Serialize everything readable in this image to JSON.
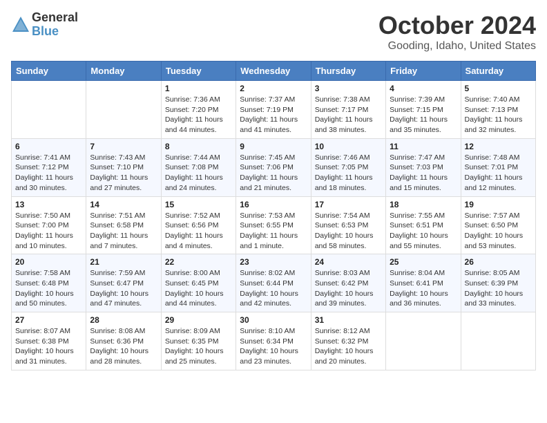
{
  "header": {
    "logo_general": "General",
    "logo_blue": "Blue",
    "month_title": "October 2024",
    "location": "Gooding, Idaho, United States"
  },
  "days_of_week": [
    "Sunday",
    "Monday",
    "Tuesday",
    "Wednesday",
    "Thursday",
    "Friday",
    "Saturday"
  ],
  "weeks": [
    [
      {
        "day": "",
        "info": ""
      },
      {
        "day": "",
        "info": ""
      },
      {
        "day": "1",
        "sunrise": "Sunrise: 7:36 AM",
        "sunset": "Sunset: 7:20 PM",
        "daylight": "Daylight: 11 hours and 44 minutes."
      },
      {
        "day": "2",
        "sunrise": "Sunrise: 7:37 AM",
        "sunset": "Sunset: 7:19 PM",
        "daylight": "Daylight: 11 hours and 41 minutes."
      },
      {
        "day": "3",
        "sunrise": "Sunrise: 7:38 AM",
        "sunset": "Sunset: 7:17 PM",
        "daylight": "Daylight: 11 hours and 38 minutes."
      },
      {
        "day": "4",
        "sunrise": "Sunrise: 7:39 AM",
        "sunset": "Sunset: 7:15 PM",
        "daylight": "Daylight: 11 hours and 35 minutes."
      },
      {
        "day": "5",
        "sunrise": "Sunrise: 7:40 AM",
        "sunset": "Sunset: 7:13 PM",
        "daylight": "Daylight: 11 hours and 32 minutes."
      }
    ],
    [
      {
        "day": "6",
        "sunrise": "Sunrise: 7:41 AM",
        "sunset": "Sunset: 7:12 PM",
        "daylight": "Daylight: 11 hours and 30 minutes."
      },
      {
        "day": "7",
        "sunrise": "Sunrise: 7:43 AM",
        "sunset": "Sunset: 7:10 PM",
        "daylight": "Daylight: 11 hours and 27 minutes."
      },
      {
        "day": "8",
        "sunrise": "Sunrise: 7:44 AM",
        "sunset": "Sunset: 7:08 PM",
        "daylight": "Daylight: 11 hours and 24 minutes."
      },
      {
        "day": "9",
        "sunrise": "Sunrise: 7:45 AM",
        "sunset": "Sunset: 7:06 PM",
        "daylight": "Daylight: 11 hours and 21 minutes."
      },
      {
        "day": "10",
        "sunrise": "Sunrise: 7:46 AM",
        "sunset": "Sunset: 7:05 PM",
        "daylight": "Daylight: 11 hours and 18 minutes."
      },
      {
        "day": "11",
        "sunrise": "Sunrise: 7:47 AM",
        "sunset": "Sunset: 7:03 PM",
        "daylight": "Daylight: 11 hours and 15 minutes."
      },
      {
        "day": "12",
        "sunrise": "Sunrise: 7:48 AM",
        "sunset": "Sunset: 7:01 PM",
        "daylight": "Daylight: 11 hours and 12 minutes."
      }
    ],
    [
      {
        "day": "13",
        "sunrise": "Sunrise: 7:50 AM",
        "sunset": "Sunset: 7:00 PM",
        "daylight": "Daylight: 11 hours and 10 minutes."
      },
      {
        "day": "14",
        "sunrise": "Sunrise: 7:51 AM",
        "sunset": "Sunset: 6:58 PM",
        "daylight": "Daylight: 11 hours and 7 minutes."
      },
      {
        "day": "15",
        "sunrise": "Sunrise: 7:52 AM",
        "sunset": "Sunset: 6:56 PM",
        "daylight": "Daylight: 11 hours and 4 minutes."
      },
      {
        "day": "16",
        "sunrise": "Sunrise: 7:53 AM",
        "sunset": "Sunset: 6:55 PM",
        "daylight": "Daylight: 11 hours and 1 minute."
      },
      {
        "day": "17",
        "sunrise": "Sunrise: 7:54 AM",
        "sunset": "Sunset: 6:53 PM",
        "daylight": "Daylight: 10 hours and 58 minutes."
      },
      {
        "day": "18",
        "sunrise": "Sunrise: 7:55 AM",
        "sunset": "Sunset: 6:51 PM",
        "daylight": "Daylight: 10 hours and 55 minutes."
      },
      {
        "day": "19",
        "sunrise": "Sunrise: 7:57 AM",
        "sunset": "Sunset: 6:50 PM",
        "daylight": "Daylight: 10 hours and 53 minutes."
      }
    ],
    [
      {
        "day": "20",
        "sunrise": "Sunrise: 7:58 AM",
        "sunset": "Sunset: 6:48 PM",
        "daylight": "Daylight: 10 hours and 50 minutes."
      },
      {
        "day": "21",
        "sunrise": "Sunrise: 7:59 AM",
        "sunset": "Sunset: 6:47 PM",
        "daylight": "Daylight: 10 hours and 47 minutes."
      },
      {
        "day": "22",
        "sunrise": "Sunrise: 8:00 AM",
        "sunset": "Sunset: 6:45 PM",
        "daylight": "Daylight: 10 hours and 44 minutes."
      },
      {
        "day": "23",
        "sunrise": "Sunrise: 8:02 AM",
        "sunset": "Sunset: 6:44 PM",
        "daylight": "Daylight: 10 hours and 42 minutes."
      },
      {
        "day": "24",
        "sunrise": "Sunrise: 8:03 AM",
        "sunset": "Sunset: 6:42 PM",
        "daylight": "Daylight: 10 hours and 39 minutes."
      },
      {
        "day": "25",
        "sunrise": "Sunrise: 8:04 AM",
        "sunset": "Sunset: 6:41 PM",
        "daylight": "Daylight: 10 hours and 36 minutes."
      },
      {
        "day": "26",
        "sunrise": "Sunrise: 8:05 AM",
        "sunset": "Sunset: 6:39 PM",
        "daylight": "Daylight: 10 hours and 33 minutes."
      }
    ],
    [
      {
        "day": "27",
        "sunrise": "Sunrise: 8:07 AM",
        "sunset": "Sunset: 6:38 PM",
        "daylight": "Daylight: 10 hours and 31 minutes."
      },
      {
        "day": "28",
        "sunrise": "Sunrise: 8:08 AM",
        "sunset": "Sunset: 6:36 PM",
        "daylight": "Daylight: 10 hours and 28 minutes."
      },
      {
        "day": "29",
        "sunrise": "Sunrise: 8:09 AM",
        "sunset": "Sunset: 6:35 PM",
        "daylight": "Daylight: 10 hours and 25 minutes."
      },
      {
        "day": "30",
        "sunrise": "Sunrise: 8:10 AM",
        "sunset": "Sunset: 6:34 PM",
        "daylight": "Daylight: 10 hours and 23 minutes."
      },
      {
        "day": "31",
        "sunrise": "Sunrise: 8:12 AM",
        "sunset": "Sunset: 6:32 PM",
        "daylight": "Daylight: 10 hours and 20 minutes."
      },
      {
        "day": "",
        "info": ""
      },
      {
        "day": "",
        "info": ""
      }
    ]
  ]
}
